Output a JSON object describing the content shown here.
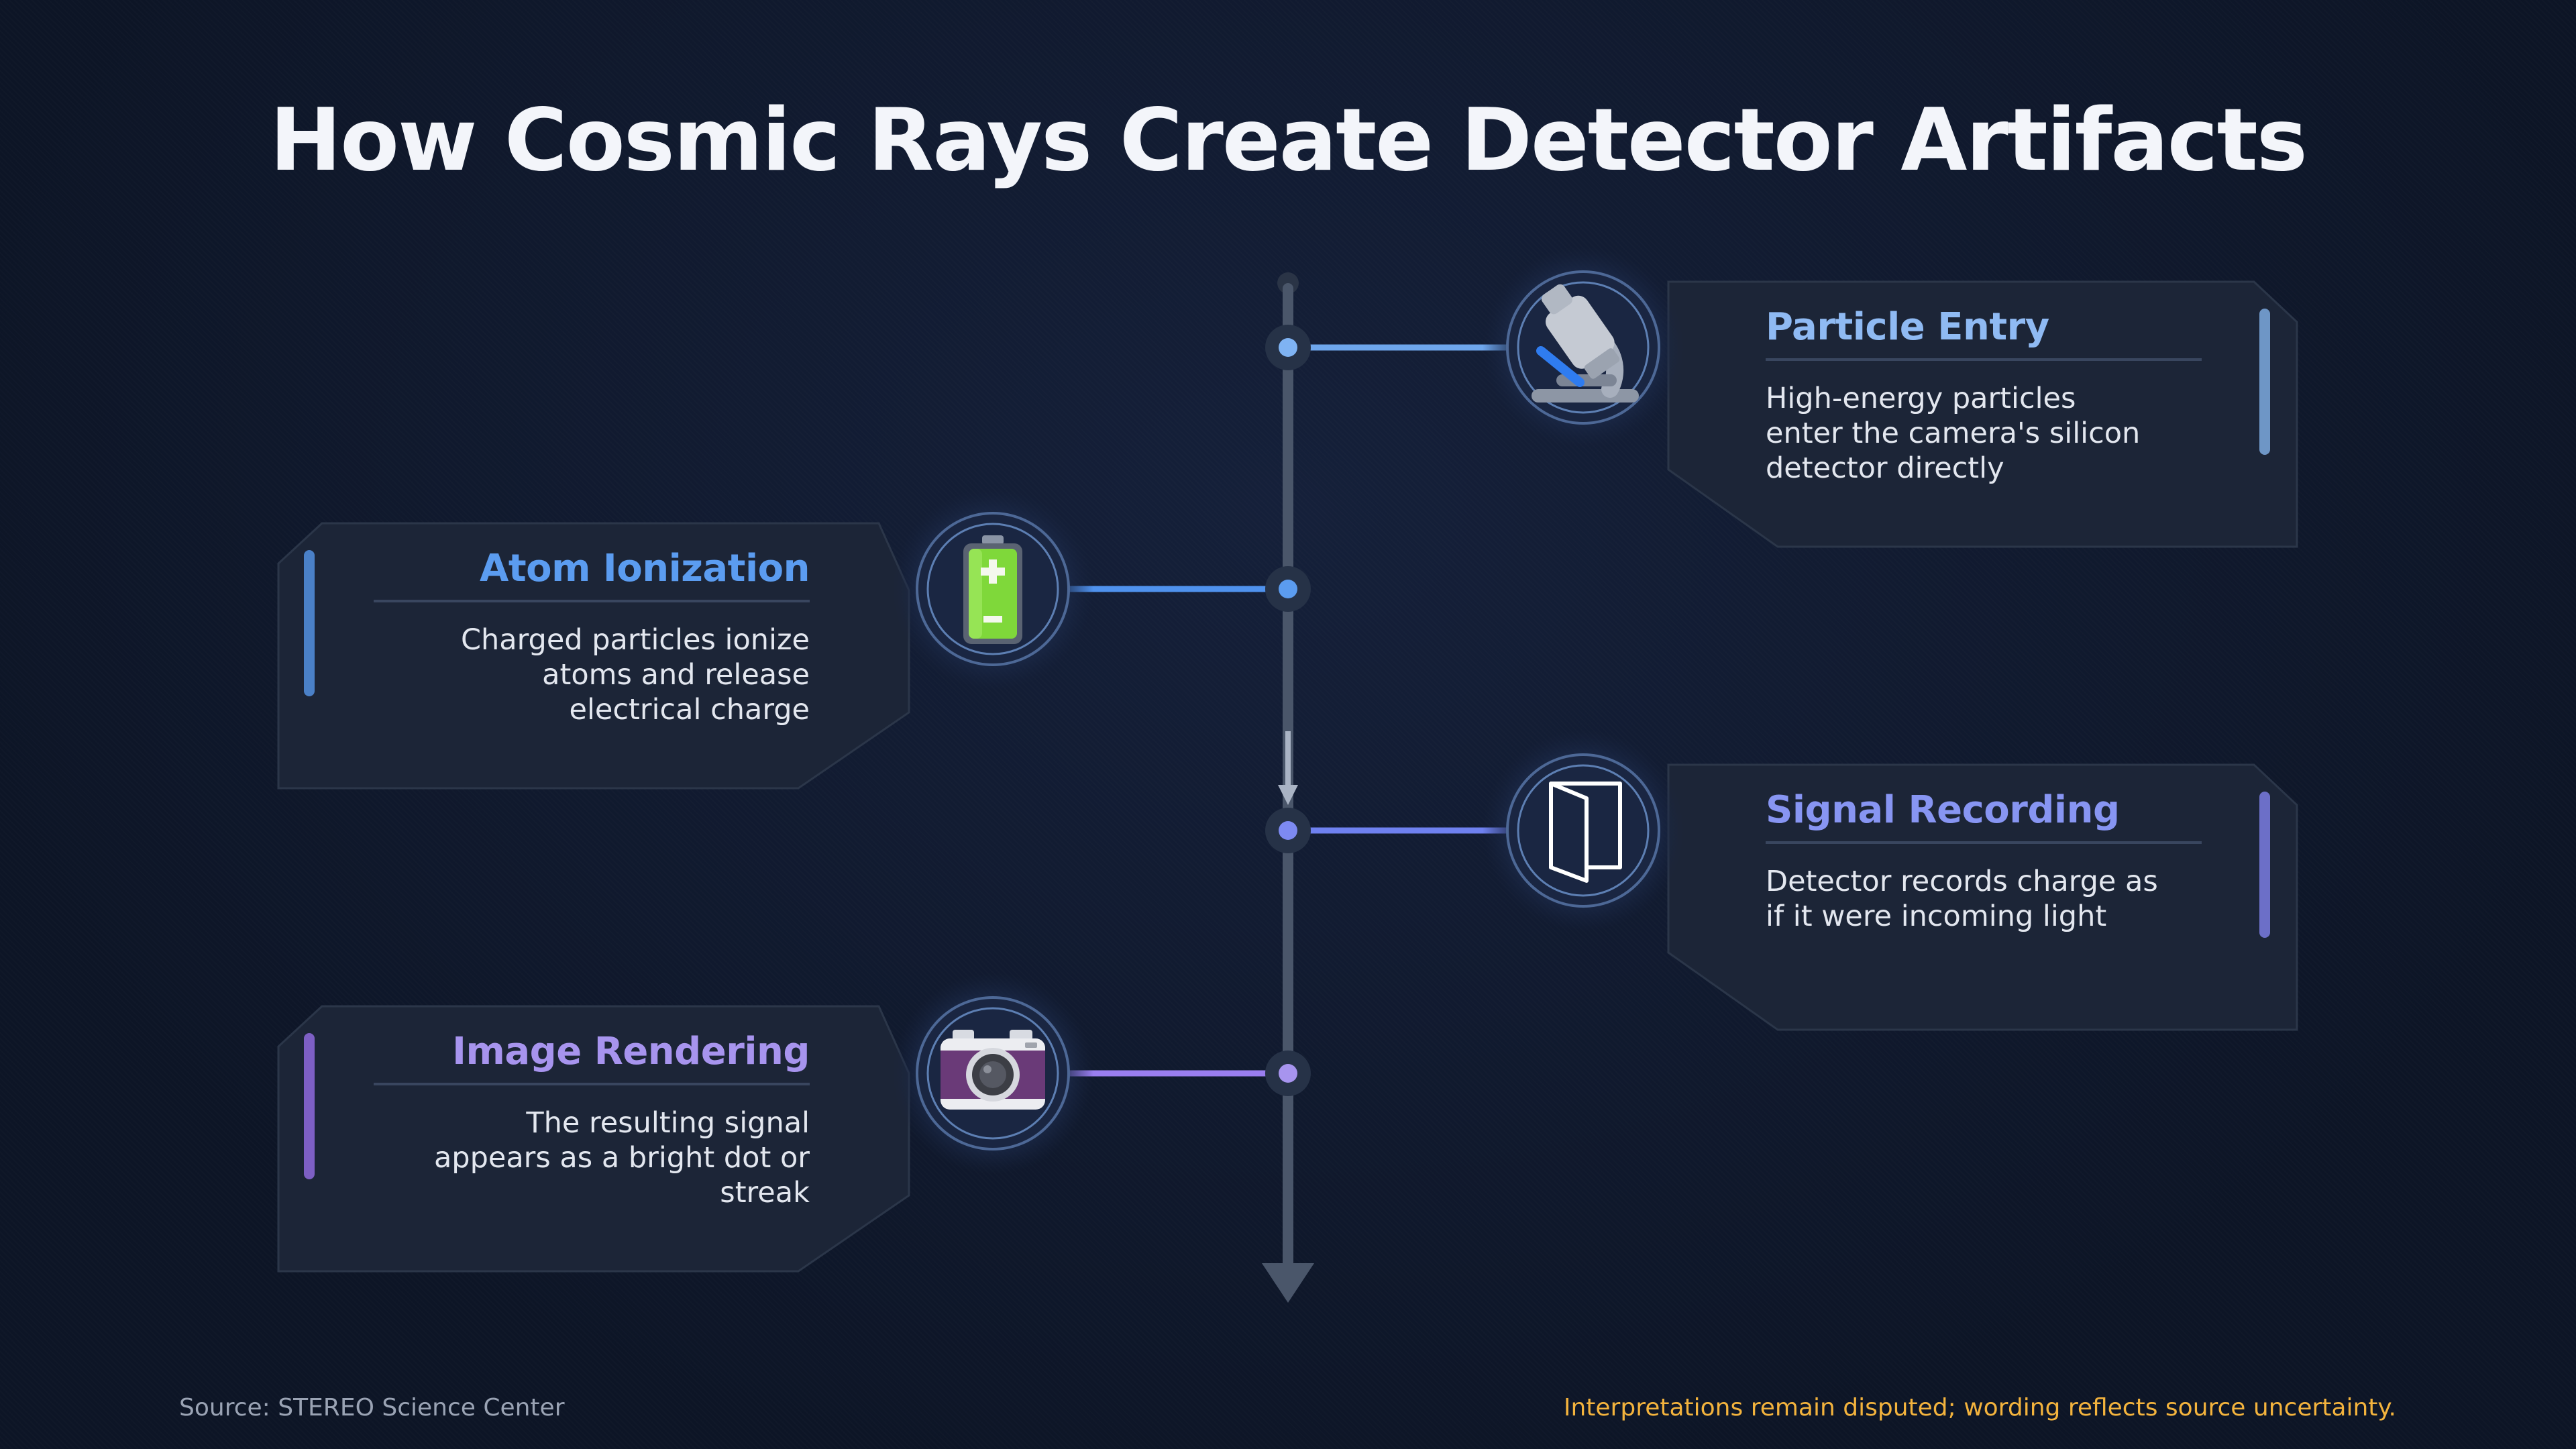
{
  "title": "How Cosmic Rays Create Detector Artifacts",
  "steps": [
    {
      "title": "Particle Entry",
      "description": "High-energy particles enter the camera's silicon detector directly",
      "side": "right",
      "icon": "microscope-icon",
      "accent": "#8fbaf3"
    },
    {
      "title": "Atom Ionization",
      "description": "Charged particles ionize atoms and release electrical charge",
      "side": "left",
      "icon": "battery-icon",
      "accent": "#5b9cf0"
    },
    {
      "title": "Signal Recording",
      "description": "Detector records charge as if it were incoming light",
      "side": "right",
      "icon": "open-door-icon",
      "accent": "#8795f2"
    },
    {
      "title": "Image Rendering",
      "description": "The resulting signal appears as a bright dot or streak",
      "side": "left",
      "icon": "camera-icon",
      "accent": "#a794ee"
    }
  ],
  "footer": {
    "source": "Source: STEREO Science Center",
    "note": "Interpretations remain disputed; wording reflects source uncertainty."
  },
  "colors": {
    "background": "#111a2c",
    "card": "#1c2537",
    "card_border": "#2b3649",
    "spine": "#4a566a",
    "note": "#f3b33d"
  }
}
